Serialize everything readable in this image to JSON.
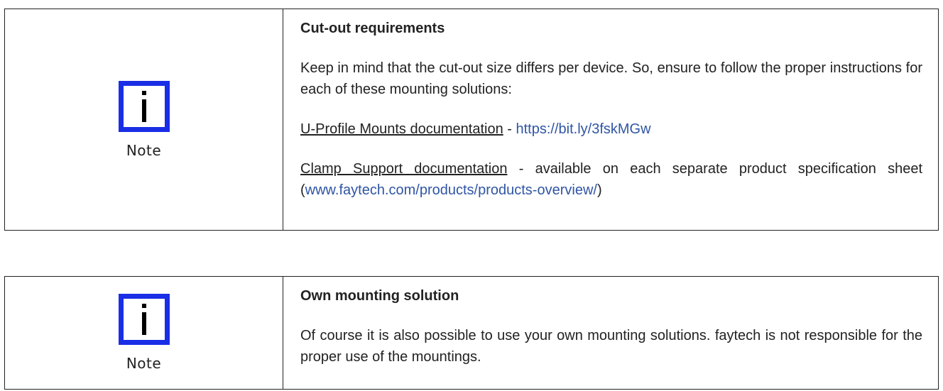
{
  "notes": [
    {
      "label": "Note",
      "title": "Cut-out requirements",
      "paragraph1": "Keep in mind that the cut-out size differs per device. So, ensure to follow the proper instructions for each of these mounting solutions:",
      "line2": {
        "doc": "U-Profile Mounts documentation",
        "sep": " - ",
        "url": "https://bit.ly/3fskMGw"
      },
      "line3": {
        "doc": "Clamp Support documentation",
        "mid": " - available on each separate product specification sheet (",
        "url": "www.faytech.com/products/products-overview/",
        "end": ")"
      }
    },
    {
      "label": "Note",
      "title": "Own mounting solution",
      "paragraph1": "Of course it is also possible to use your own mounting solutions. faytech is not responsible for the proper use of the mountings."
    }
  ],
  "colors": {
    "icon_blue": "#1a2ee6",
    "link_blue": "#2f55a4",
    "text": "#222222"
  },
  "icons": [
    "info-icon"
  ]
}
